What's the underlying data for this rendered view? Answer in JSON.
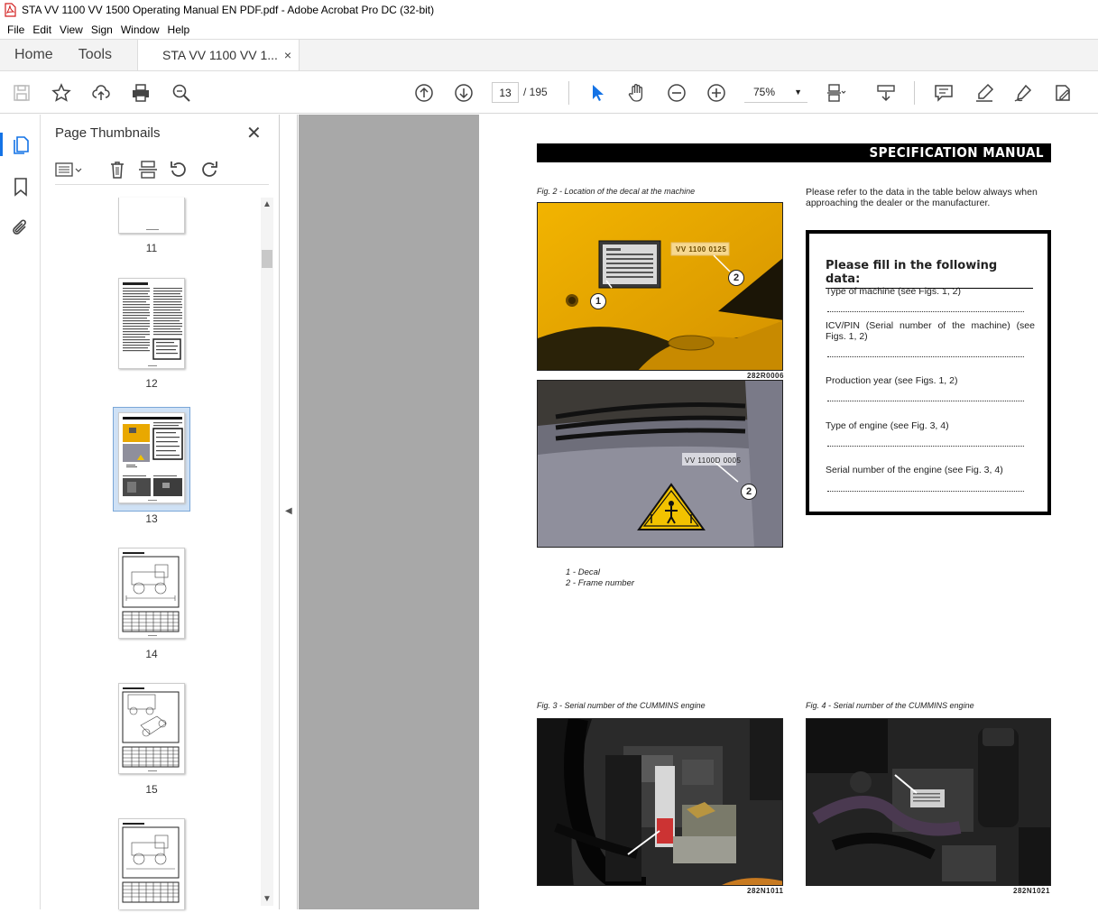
{
  "window": {
    "title": "STA VV 1100 VV 1500 Operating Manual EN PDF.pdf - Adobe Acrobat Pro DC (32-bit)"
  },
  "menu": [
    "File",
    "Edit",
    "View",
    "Sign",
    "Window",
    "Help"
  ],
  "tabs": {
    "home": "Home",
    "tools": "Tools",
    "document": "STA VV 1100 VV 1...",
    "close": "×"
  },
  "toolbar": {
    "current_page": "13",
    "page_total": "/  195",
    "zoom": "75%"
  },
  "thumbnails": {
    "title": "Page Thumbnails",
    "close": "✕",
    "pages": [
      "11",
      "12",
      "13",
      "14",
      "15"
    ],
    "selected_page": "13"
  },
  "document": {
    "header": "SPECIFICATION MANUAL",
    "fig2_caption": "Fig. 2 - Location of the decal at the machine",
    "photo1_code": "282R0006",
    "photo1_plate_text": "VV 1100 0125",
    "photo2_plate_text": "VV 1100D 0005",
    "callouts": [
      "1",
      "2",
      "2"
    ],
    "intro": "Please refer to the data in the table below always when approaching the dealer or the manufacturer.",
    "fill_box": {
      "title": "Please fill in the following data:",
      "items": [
        "Type of machine (see Figs. 1, 2)",
        "ICV/PIN (Serial number of the machine) (see Figs. 1, 2)",
        "Production year (see Figs. 1, 2)",
        "Type of engine (see Fig. 3, 4)",
        "Serial number of the engine (see Fig. 3, 4)"
      ]
    },
    "legend": [
      "1 - Decal",
      "2 - Frame number"
    ],
    "fig3_caption": "Fig. 3 - Serial number of the CUMMINS engine",
    "fig4_caption": "Fig. 4 - Serial number of the CUMMINS engine",
    "photo3_code": "282N1011",
    "photo4_code": "282N1021"
  },
  "colors": {
    "accent": "#1473e6",
    "machine_yellow": "#e9a800",
    "machine_grey": "#8f8f9c",
    "doc_background": "#a8a8a8"
  }
}
